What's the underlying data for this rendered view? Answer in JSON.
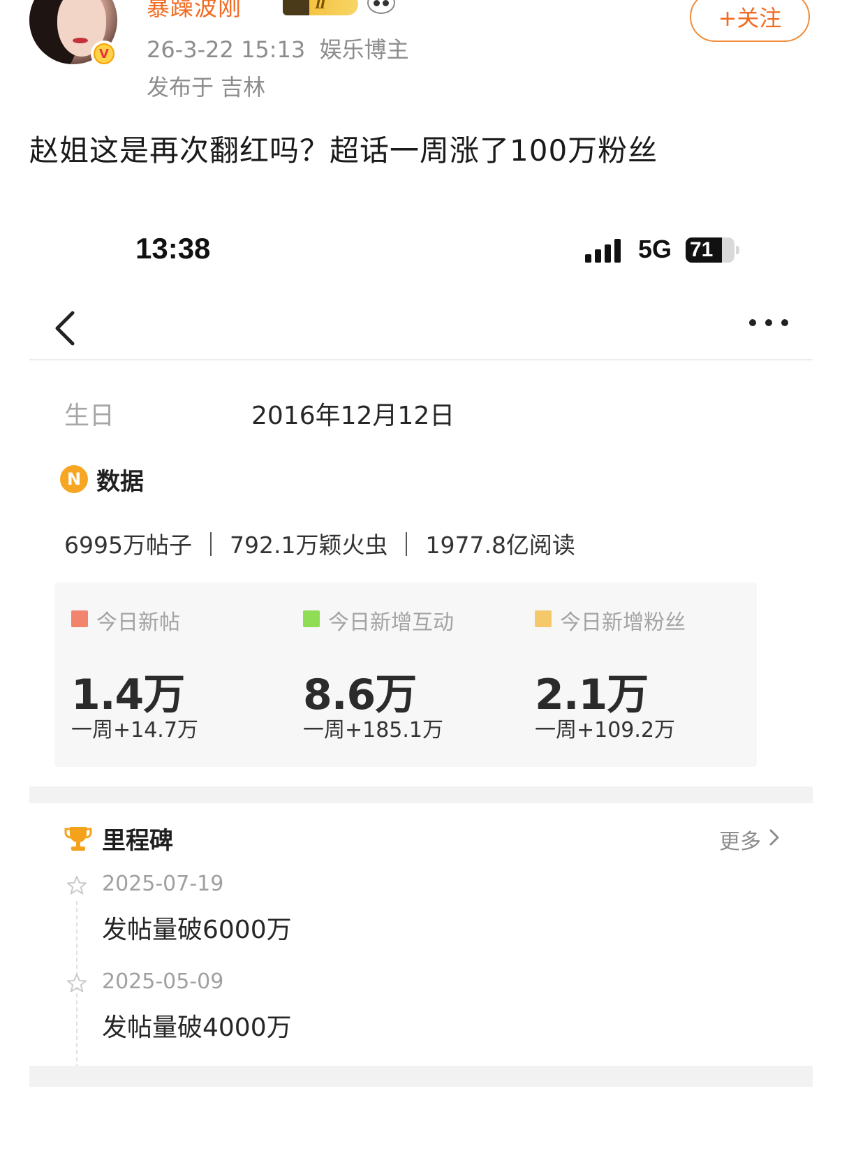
{
  "post": {
    "username": "暴躁波刚",
    "level_badge": "Ⅱ",
    "timestamp": "26-3-22 15:13",
    "role": "娱乐博主",
    "location": "发布于 吉林",
    "follow_label": "+关注",
    "text": "赵姐这是再次翻红吗？超话一周涨了100万粉丝"
  },
  "phone": {
    "time": "13:38",
    "network": "5G",
    "battery": "71"
  },
  "profile": {
    "birthday_label": "生日",
    "birthday_value": "2016年12月12日",
    "data_title": "数据",
    "stats": {
      "posts": "6995万帖子",
      "fireflies": "792.1万颖火虫",
      "reads": "1977.8亿阅读"
    },
    "cards": [
      {
        "label": "今日新帖",
        "value": "1.4万",
        "week": "一周+14.7万",
        "color": "#f0846c"
      },
      {
        "label": "今日新增互动",
        "value": "8.6万",
        "week": "一周+185.1万",
        "color": "#8fdc55"
      },
      {
        "label": "今日新增粉丝",
        "value": "2.1万",
        "week": "一周+109.2万",
        "color": "#f5c96a"
      }
    ]
  },
  "milestones": {
    "title": "里程碑",
    "more_label": "更多",
    "items": [
      {
        "date": "2025-07-19",
        "text": "发帖量破6000万"
      },
      {
        "date": "2025-05-09",
        "text": "发帖量破4000万"
      }
    ]
  },
  "colors": {
    "accent_orange": "#f26b22",
    "data_icon": "#f6a623",
    "trophy": "#f4a21b"
  }
}
